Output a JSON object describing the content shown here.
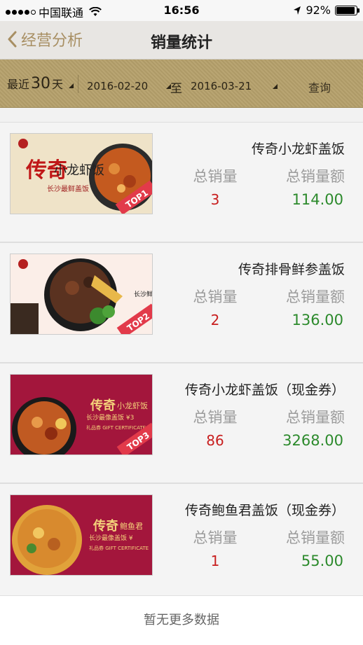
{
  "status": {
    "carrier": "中国联通",
    "time": "16:56",
    "battery": "92%",
    "battery_level": 0.92
  },
  "nav": {
    "back_label": "经营分析",
    "title": "销量统计"
  },
  "filter": {
    "range_prefix": "最近",
    "range_num": "30",
    "range_suffix": "天",
    "start_date": "2016-02-20",
    "to_label": "至",
    "end_date": "2016-03-21",
    "query_label": "查询"
  },
  "labels": {
    "qty": "总销量",
    "amount": "总销量额"
  },
  "items": [
    {
      "name": "传奇小龙虾盖饭",
      "qty": "3",
      "amount": "114.00"
    },
    {
      "name": "传奇排骨鲜参盖饭",
      "qty": "2",
      "amount": "136.00"
    },
    {
      "name": "传奇小龙虾盖饭（现金券）",
      "qty": "86",
      "amount": "3268.00"
    },
    {
      "name": "传奇鲍鱼君盖饭（现金券）",
      "qty": "1",
      "amount": "55.00"
    }
  ],
  "thumbs": {
    "t1": {
      "brand": "传奇",
      "line": "小龙虾饭",
      "sub": "长沙最鲜盖饭",
      "badge": "TOP1"
    },
    "t2": {
      "side": "长沙鲜",
      "badge": "TOP2"
    },
    "t3": {
      "brand": "传奇",
      "line": "小龙虾饭",
      "sub": "长沙最像盖饭 ¥3",
      "note": "礼品券 GIFT CERTIFICATE",
      "badge": "TOP3"
    },
    "t4": {
      "brand": "传奇",
      "line": "鲍鱼君",
      "sub": "长沙最像盖饭 ¥",
      "note": "礼品券 GIFT CERTIFICATE"
    }
  },
  "footer": "暂无更多数据",
  "colors": {
    "accent": "#a88f63",
    "filter_bg": "#b5a06b",
    "qty_red": "#c81e1e",
    "amount_green": "#2c8a2c"
  }
}
